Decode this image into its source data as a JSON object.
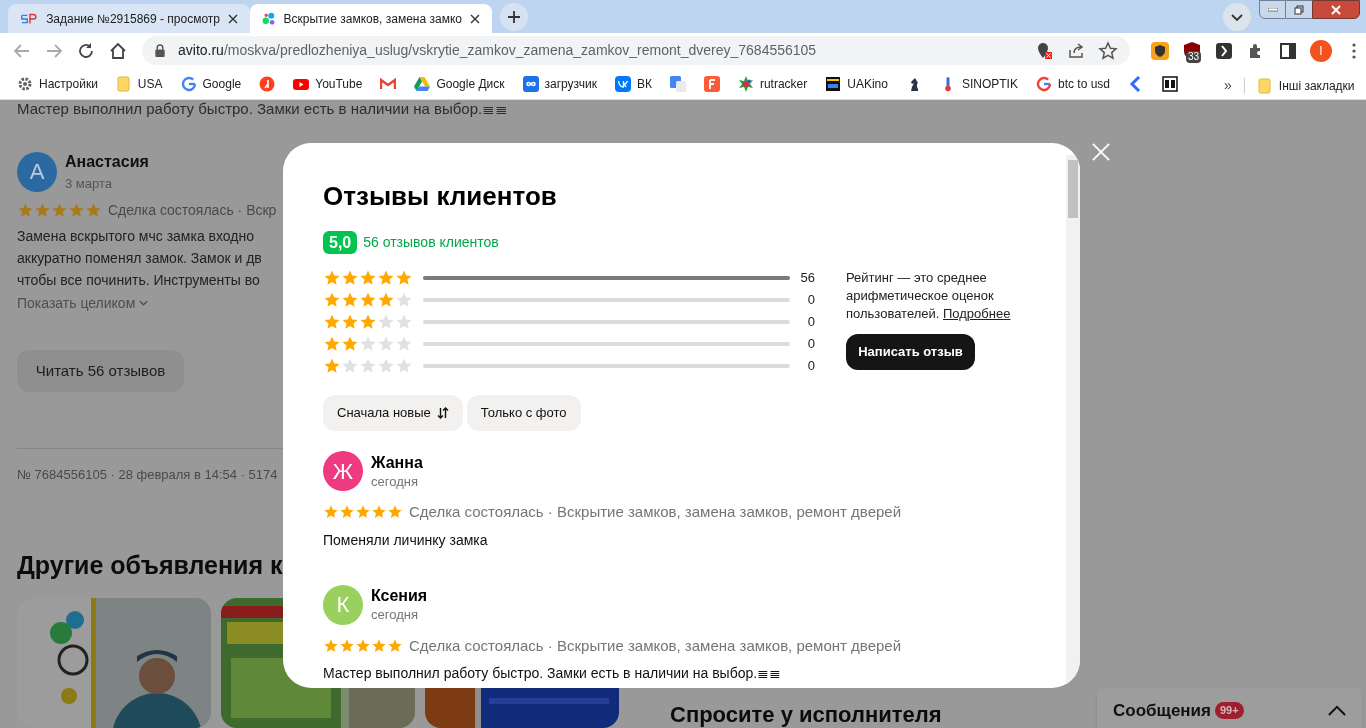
{
  "browser": {
    "tabs": [
      {
        "title": "Задание №2915869 - просмотр",
        "selected": false
      },
      {
        "title": "Вскрытие замков, замена замко",
        "selected": true
      }
    ],
    "address": {
      "host": "avito.ru",
      "path": "/moskva/predlozheniya_uslug/vskrytie_zamkov_zamena_zamkov_remont_dverey_7684556105"
    },
    "extension_badge": "33",
    "profile_initial": "I",
    "bookmarks": [
      {
        "kind": "labeled",
        "label": "Настройки"
      },
      {
        "kind": "labeled",
        "label": "USA"
      },
      {
        "kind": "labeled",
        "label": "Google"
      },
      {
        "kind": "icon"
      },
      {
        "kind": "labeled",
        "label": "YouTube"
      },
      {
        "kind": "icon"
      },
      {
        "kind": "labeled",
        "label": "Google Диск"
      },
      {
        "kind": "labeled",
        "label": "загрузчик"
      },
      {
        "kind": "labeled",
        "label": "ВК"
      },
      {
        "kind": "icon"
      },
      {
        "kind": "icon"
      },
      {
        "kind": "labeled",
        "label": "rutracker"
      },
      {
        "kind": "labeled",
        "label": "UAKino"
      },
      {
        "kind": "icon"
      },
      {
        "kind": "labeled",
        "label": "SINOPTIK"
      },
      {
        "kind": "labeled",
        "label": "btc to usd"
      },
      {
        "kind": "icon"
      },
      {
        "kind": "icon"
      }
    ],
    "more_bookmarks": "»",
    "other_bookmarks": "Інші закладки"
  },
  "page": {
    "top_text": "Мастер выполнил работу быстро. Замки есть в наличии на выбор.≣≣",
    "review": {
      "initial": "А",
      "author": "Анастасия",
      "date": "3 марта",
      "stars": 5,
      "meta": "Сделка состоялась · Вскр",
      "lines": [
        "Замена вскрытого мчс замка входно",
        "аккуратно поменял замок. Замок и дв",
        "чтобы все починить. Инструменты во"
      ],
      "show_more": "Показать целиком"
    },
    "read_button": "Читать 56 отзывов",
    "listing_meta": "№ 7684556105 · 28 февраля в 14:54 · 5174",
    "other_heading": "Другие объявления к",
    "ask_heading": "Спросите у исполнителя",
    "messages": {
      "label": "Сообщения",
      "badge": "99+"
    }
  },
  "modal": {
    "title": "Отзывы клиентов",
    "rating": "5,0",
    "count_label": "56 отзывов клиентов",
    "distribution": [
      {
        "stars": 5,
        "level": 1,
        "count": "56"
      },
      {
        "stars": 4,
        "level": 0,
        "count": "0"
      },
      {
        "stars": 3,
        "level": 0,
        "count": "0"
      },
      {
        "stars": 2,
        "level": 0,
        "count": "0"
      },
      {
        "stars": 1,
        "level": 0,
        "count": "0"
      }
    ],
    "note": "Рейтинг — это среднее арифметическое оценок пользователей.",
    "note_link": "Подробнее",
    "write_button": "Написать отзыв",
    "filters": [
      {
        "label": "Сначала новые",
        "kind": "sort"
      },
      {
        "label": "Только с фото",
        "kind": "plain"
      }
    ],
    "reviews": [
      {
        "initial": "Ж",
        "name": "Жанна",
        "date": "сегодня",
        "color": "#ee3a7e",
        "stars": 5,
        "meta": "Сделка состоялась · Вскрытие замков, замена замков, ремонт дверей",
        "text": "Поменяли личинку замка"
      },
      {
        "initial": "К",
        "name": "Ксения",
        "date": "сегодня",
        "color": "#99d05e",
        "stars": 5,
        "meta": "Сделка состоялась · Вскрытие замков, замена замков, ремонт дверей",
        "text": "Мастер выполнил работу быстро. Замки есть в наличии на выбор.≣≣"
      }
    ]
  }
}
